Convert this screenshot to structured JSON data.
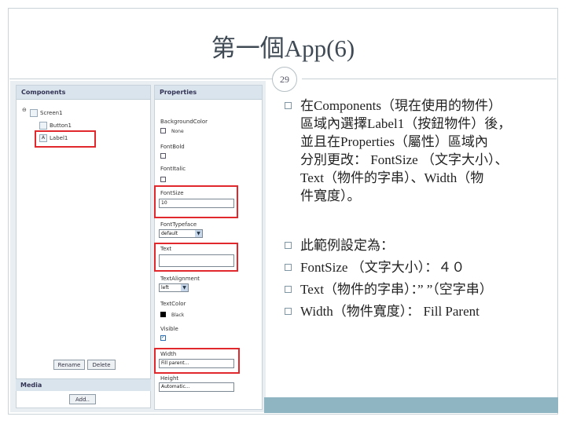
{
  "slide": {
    "title": "第一個App(6)",
    "page_number": "29"
  },
  "designer": {
    "components_header": "Components",
    "properties_header": "Properties",
    "tree": {
      "toggle": "⊖",
      "screen": "Screen1",
      "button": "Button1",
      "label": "Label1"
    },
    "rename_button": "Rename",
    "delete_button": "Delete",
    "media_header": "Media",
    "add_button": "Add..",
    "properties": {
      "background_color_label": "BackgroundColor",
      "background_color_value": "None",
      "font_bold_label": "FontBold",
      "font_italic_label": "FontItalic",
      "font_size_label": "FontSize",
      "font_size_value": "10",
      "font_typeface_label": "FontTypeface",
      "font_typeface_value": "default",
      "text_label": "Text",
      "text_value": "",
      "text_alignment_label": "TextAlignment",
      "text_alignment_value": "left",
      "text_color_label": "TextColor",
      "text_color_value": "Black",
      "visible_label": "Visible",
      "width_label": "Width",
      "width_value": "Fill parent...",
      "height_label": "Height",
      "height_value": "Automatic..."
    }
  },
  "bullets": {
    "p1_line1": "在Components（現在使用的物件）",
    "p1_line2": "區域內選擇Label1（按鈕物件）後，",
    "p1_line3": "並且在Properties（屬性）區域內",
    "p1_line4": "分別更改： FontSize （文字大小）、",
    "p1_line5": "Text（物件的字串）、Width（物",
    "p1_line6": "件寬度）。",
    "p2": "此範例設定為：",
    "p3": "FontSize （文字大小）：４０",
    "p4": "Text（物件的字串）：” ”（空字串）",
    "p5": "Width（物件寬度）： Fill Parent"
  },
  "colors": {
    "highlight": "#e0282d",
    "accent": "#8fb5c2"
  }
}
